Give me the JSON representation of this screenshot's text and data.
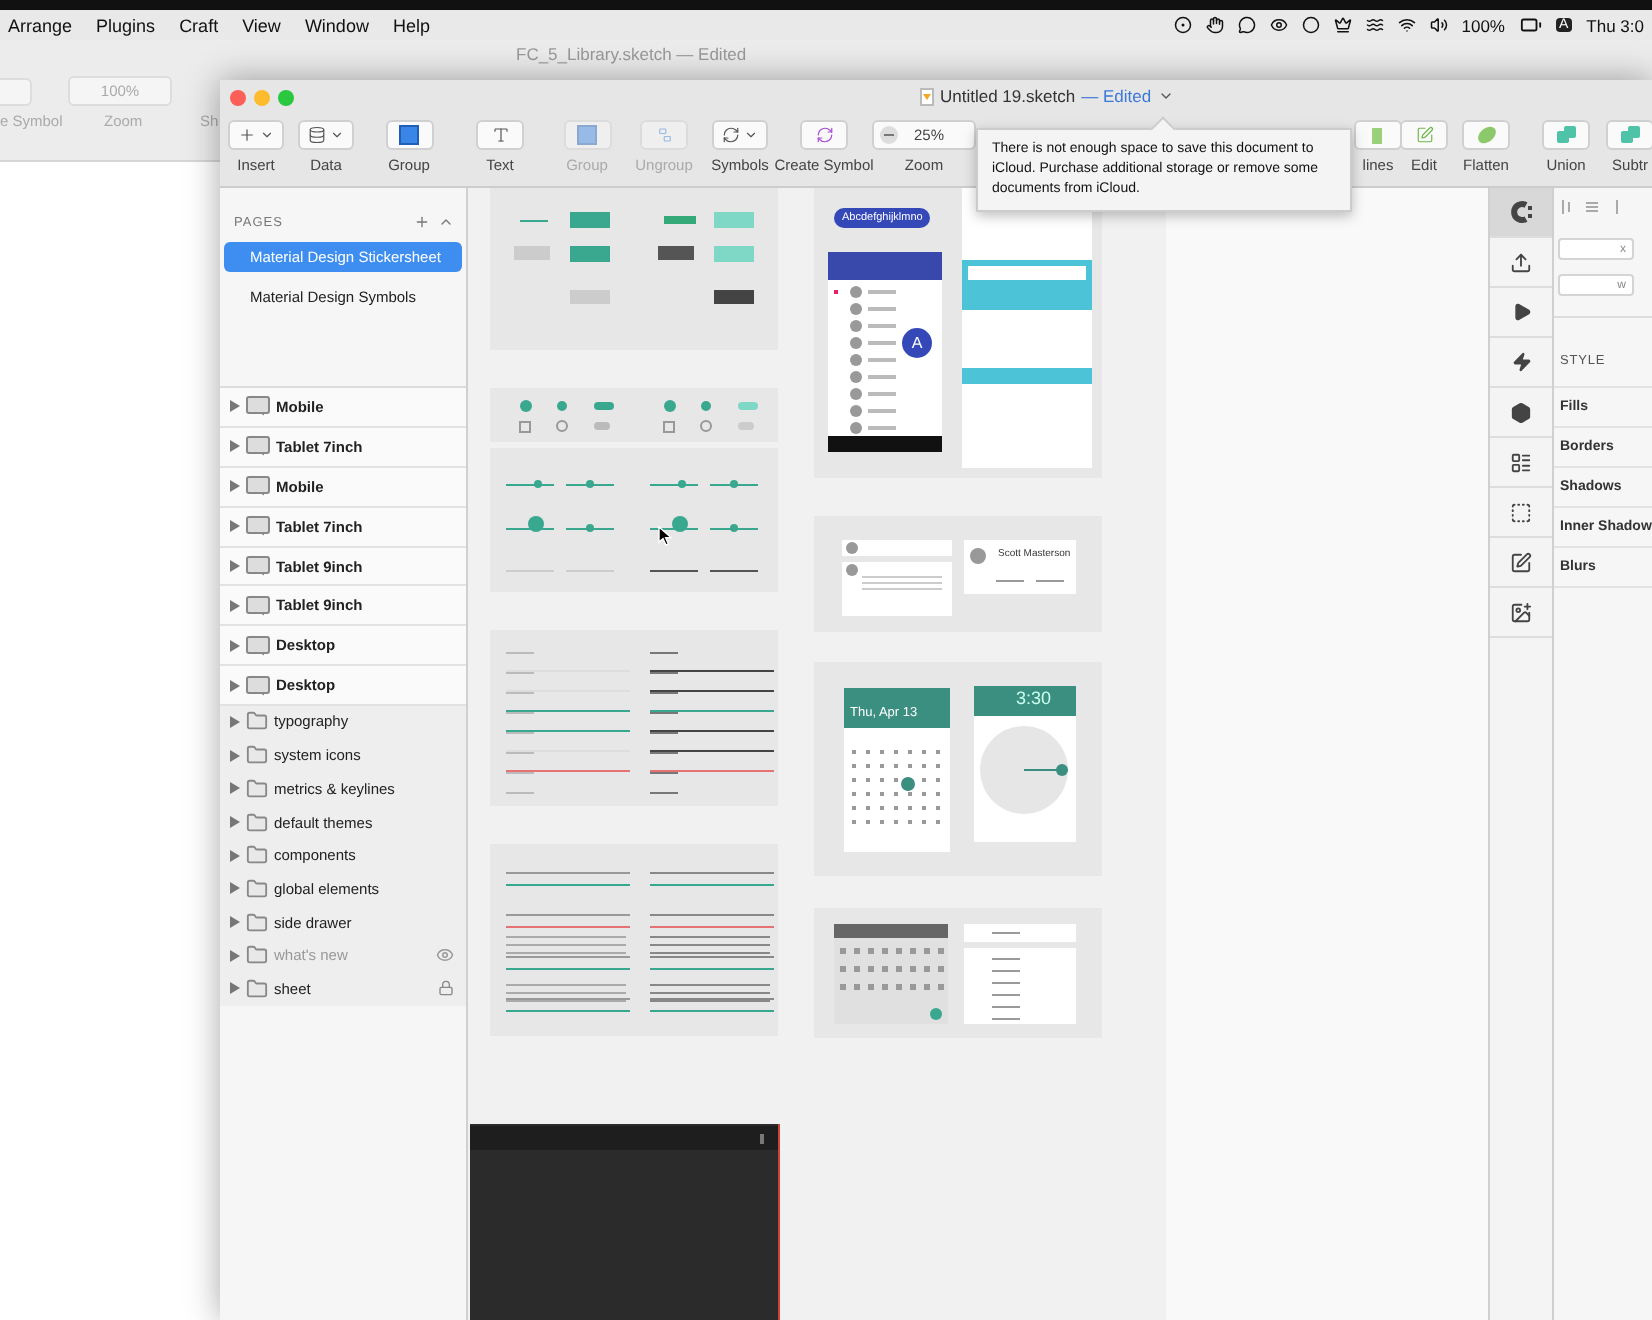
{
  "menu_bar": {
    "items": [
      "Arrange",
      "Plugins",
      "Craft",
      "View",
      "Window",
      "Help"
    ],
    "battery": "100%",
    "input_source": "A",
    "clock": "Thu 3:0"
  },
  "background_window": {
    "title": "FC_5_Library.sketch",
    "status": "— Edited",
    "symbol_label": "e Symbol",
    "zoom_value": "100%",
    "zoom_label": "Zoom",
    "next_label": "Sh"
  },
  "window": {
    "title": "Untitled 19.sketch",
    "status": "— Edited"
  },
  "toolbar": [
    {
      "kind": "insert",
      "label": "Insert",
      "disabled": false
    },
    {
      "kind": "data",
      "label": "Data",
      "disabled": false
    },
    {
      "kind": "group",
      "label": "Group",
      "disabled": false
    },
    {
      "kind": "text",
      "label": "Text",
      "disabled": false
    },
    {
      "kind": "group",
      "label": "Group",
      "disabled": true
    },
    {
      "kind": "ungroup",
      "label": "Ungroup",
      "disabled": true
    },
    {
      "kind": "symbols",
      "label": "Symbols",
      "disabled": false
    },
    {
      "kind": "create_symbol",
      "label": "Create Symbol",
      "disabled": false
    },
    {
      "kind": "zoom",
      "label": "Zoom",
      "value": "25%",
      "disabled": false
    },
    {
      "kind": "outline",
      "label": "lines",
      "disabled": false
    },
    {
      "kind": "edit",
      "label": "Edit",
      "disabled": false
    },
    {
      "kind": "flatten",
      "label": "Flatten",
      "disabled": false
    },
    {
      "kind": "union",
      "label": "Union",
      "disabled": false
    },
    {
      "kind": "subtract",
      "label": "Subtr",
      "disabled": false
    }
  ],
  "tooltip": "There is not enough space to save this document to iCloud. Purchase additional storage or remove some documents from iCloud.",
  "pages": {
    "header": "PAGES",
    "items": [
      {
        "label": "Material Design Stickersheet",
        "selected": true
      },
      {
        "label": "Material Design Symbols",
        "selected": false
      }
    ]
  },
  "layers": [
    {
      "kind": "artboard",
      "name": "Mobile",
      "hidden": false,
      "locked": false
    },
    {
      "kind": "artboard",
      "name": "Tablet 7inch",
      "hidden": false,
      "locked": false
    },
    {
      "kind": "artboard",
      "name": "Mobile",
      "hidden": false,
      "locked": false
    },
    {
      "kind": "artboard",
      "name": "Tablet 7inch",
      "hidden": false,
      "locked": false
    },
    {
      "kind": "artboard",
      "name": "Tablet 9inch",
      "hidden": false,
      "locked": false
    },
    {
      "kind": "artboard",
      "name": "Tablet 9inch",
      "hidden": false,
      "locked": false
    },
    {
      "kind": "artboard",
      "name": "Desktop",
      "hidden": false,
      "locked": false
    },
    {
      "kind": "artboard",
      "name": "Desktop",
      "hidden": false,
      "locked": false
    },
    {
      "kind": "group",
      "name": "typography",
      "hidden": false,
      "locked": false
    },
    {
      "kind": "group",
      "name": "system icons",
      "hidden": false,
      "locked": false
    },
    {
      "kind": "group",
      "name": "metrics & keylines",
      "hidden": false,
      "locked": false
    },
    {
      "kind": "group",
      "name": "default themes",
      "hidden": false,
      "locked": false
    },
    {
      "kind": "group",
      "name": "components",
      "hidden": false,
      "locked": false
    },
    {
      "kind": "group",
      "name": "global elements",
      "hidden": false,
      "locked": false
    },
    {
      "kind": "group",
      "name": "side drawer",
      "hidden": false,
      "locked": false
    },
    {
      "kind": "group",
      "name": "what's new",
      "hidden": true,
      "locked": false
    },
    {
      "kind": "group",
      "name": "sheet",
      "hidden": false,
      "locked": true
    }
  ],
  "canvas": {
    "chip": "Abcdefghijklmno",
    "fab": "A",
    "contact": "Scott Masterson",
    "date": "Thu, Apr 13",
    "time": "3:30"
  },
  "inspector": {
    "fields": [
      "x",
      "w"
    ],
    "style_header": "STYLE",
    "sections": [
      "Fills",
      "Borders",
      "Shadows",
      "Inner Shadow",
      "Blurs"
    ]
  }
}
